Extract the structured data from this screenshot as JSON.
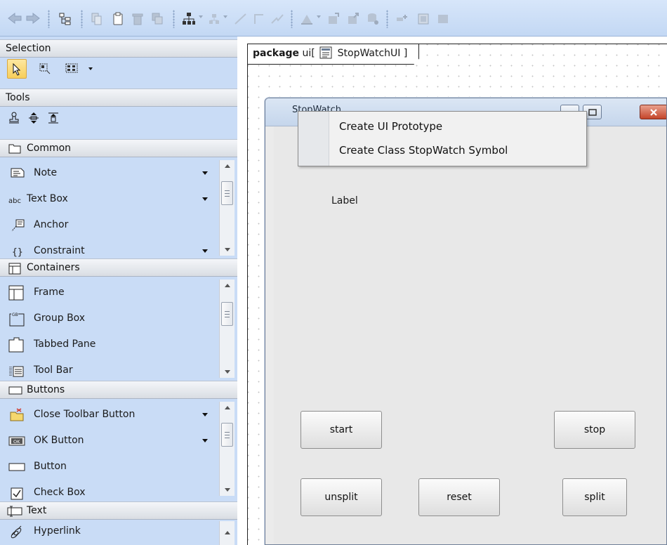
{
  "toolbar": {
    "groups": [
      [
        "back-arrow",
        "forward-arrow"
      ],
      [
        "containment-tree"
      ],
      [
        "copy",
        "paste",
        "delete",
        "clone"
      ],
      [
        "hierarchy-layout",
        "branch",
        "line",
        "elbow",
        "zigzag"
      ],
      [
        "shape",
        "import",
        "export",
        "settings"
      ],
      [
        "toggle",
        "grid",
        "box"
      ]
    ]
  },
  "palette": {
    "selection": {
      "header": "Selection"
    },
    "tools": {
      "header": "Tools"
    },
    "common": {
      "header": "Common",
      "items": [
        {
          "label": "Note",
          "icon": "note-icon",
          "has_dropdown": true
        },
        {
          "label": "Text Box",
          "icon": "text-box-icon",
          "has_dropdown": true
        },
        {
          "label": "Anchor",
          "icon": "anchor-icon",
          "has_dropdown": false
        },
        {
          "label": "Constraint",
          "icon": "constraint-icon",
          "has_dropdown": true
        }
      ]
    },
    "containers": {
      "header": "Containers",
      "items": [
        {
          "label": "Frame",
          "icon": "frame-icon"
        },
        {
          "label": "Group Box",
          "icon": "group-box-icon"
        },
        {
          "label": "Tabbed Pane",
          "icon": "tabbed-pane-icon"
        },
        {
          "label": "Tool Bar",
          "icon": "tool-bar-icon"
        }
      ]
    },
    "buttons": {
      "header": "Buttons",
      "items": [
        {
          "label": "Close Toolbar Button",
          "icon": "close-toolbar-button-icon",
          "has_dropdown": true
        },
        {
          "label": "OK Button",
          "icon": "ok-button-icon",
          "has_dropdown": true
        },
        {
          "label": "Button",
          "icon": "button-icon",
          "has_dropdown": false
        },
        {
          "label": "Check Box",
          "icon": "check-box-icon",
          "has_dropdown": false
        }
      ]
    },
    "text": {
      "header": "Text",
      "items": [
        {
          "label": "Hyperlink",
          "icon": "hyperlink-icon"
        }
      ]
    }
  },
  "canvas": {
    "frame_keyword": "package",
    "frame_name": "ui[",
    "frame_diagram": "StopWatchUI ]",
    "prototype": {
      "title": "StopWatch",
      "label": "Label",
      "buttons": {
        "start": "start",
        "stop": "stop",
        "unsplit": "unsplit",
        "reset": "reset",
        "split": "split"
      }
    },
    "context_menu": {
      "items": [
        "Create UI Prototype",
        "Create Class StopWatch Symbol"
      ]
    }
  },
  "colors": {
    "palette_bg": "#c9dcf6",
    "toolbar_bg": "#c3d8f4",
    "selection_active": "#f7cf5c",
    "close_button": "#c4452a"
  }
}
